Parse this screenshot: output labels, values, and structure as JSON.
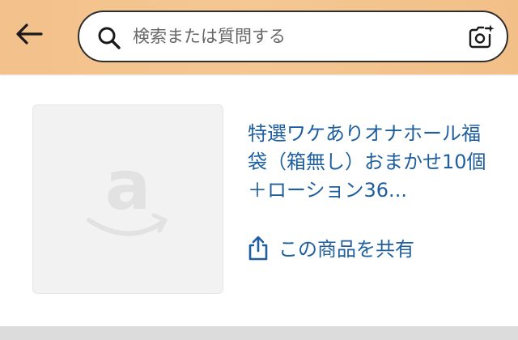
{
  "header": {
    "back_icon": "arrow-left-icon",
    "search": {
      "placeholder": "検索または質問する",
      "icon": "search-icon",
      "camera_icon": "camera-plus-icon"
    }
  },
  "product": {
    "image_logo": "a",
    "title": "特選ワケありオナホール福袋（箱無し）おまかせ10個＋ローション36...",
    "share_label": "この商品を共有",
    "share_icon": "share-icon"
  },
  "colors": {
    "header_bg": "#f4c490",
    "link": "#1f5f9f",
    "image_bg": "#f2f2f2"
  }
}
